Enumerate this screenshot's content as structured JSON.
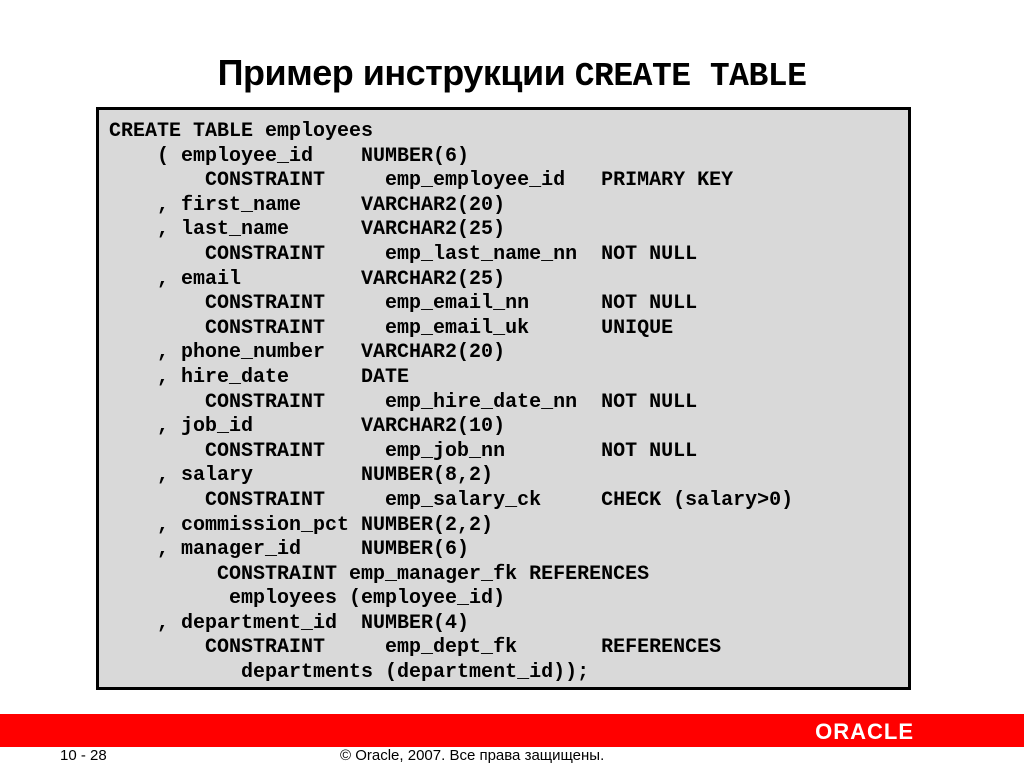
{
  "slide": {
    "title_text": "Пример инструкции ",
    "title_code": "CREATE TABLE",
    "code_lines": [
      "CREATE TABLE employees",
      "    ( employee_id    NUMBER(6)",
      "        CONSTRAINT     emp_employee_id   PRIMARY KEY",
      "    , first_name     VARCHAR2(20)",
      "    , last_name      VARCHAR2(25)",
      "        CONSTRAINT     emp_last_name_nn  NOT NULL",
      "    , email          VARCHAR2(25)",
      "        CONSTRAINT     emp_email_nn      NOT NULL",
      "        CONSTRAINT     emp_email_uk      UNIQUE",
      "    , phone_number   VARCHAR2(20)",
      "    , hire_date      DATE",
      "        CONSTRAINT     emp_hire_date_nn  NOT NULL",
      "    , job_id         VARCHAR2(10)",
      "        CONSTRAINT     emp_job_nn        NOT NULL",
      "    , salary         NUMBER(8,2)",
      "        CONSTRAINT     emp_salary_ck     CHECK (salary>0)",
      "    , commission_pct NUMBER(2,2)",
      "    , manager_id     NUMBER(6)",
      "         CONSTRAINT emp_manager_fk REFERENCES",
      "          employees (employee_id)",
      "    , department_id  NUMBER(4)",
      "        CONSTRAINT     emp_dept_fk       REFERENCES",
      "           departments (department_id));"
    ]
  },
  "footer": {
    "logo": "ORACLE",
    "page_number": "10 - 28",
    "copyright": "© Oracle, 2007. Все права защищены."
  },
  "colors": {
    "brand_red": "#ff0000",
    "code_bg": "#d9d9d9"
  }
}
